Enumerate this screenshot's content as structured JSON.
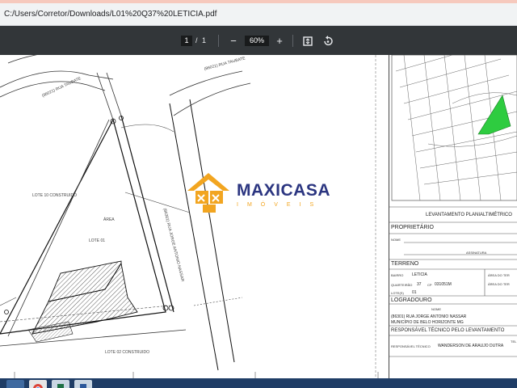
{
  "address_bar": {
    "path": "C:/Users/Corretor/Downloads/L01%20Q37%20LETICIA.pdf"
  },
  "toolbar": {
    "page_current": "1",
    "page_separator": "/",
    "page_total": "1",
    "zoom": "60%",
    "zoom_out": "−",
    "zoom_in": "+"
  },
  "logo": {
    "name": "MAXICASA",
    "tagline": "IMÓVEIS"
  },
  "plan": {
    "street_top": "(86021) RUA TAUBATE",
    "street_right": "(86021) RUA TAUBATE",
    "lote_10": "LOTE 10 CONSTRUIDO",
    "lote_01": "LOTE 01",
    "lote_02": "LOTE 02 CONSTRUIDO",
    "area_label": "ÁREA",
    "street_diag": "(86301) RUA JORGE ANTONIO NASSAR"
  },
  "title_block": {
    "title": "LEVANTAMENTO PLANIALTIMÉTRICO",
    "proprietario": "PROPRIETÁRIO",
    "nome_label": "NOME",
    "assinatura_label": "ASSINATURA",
    "terreno": "TERRENO",
    "bairro_label": "BAIRRO",
    "bairro_value": "LETICIA",
    "quarteirao_label": "QUARTEIRÃO",
    "quarteirao_value": "37",
    "cp_label": "CP",
    "cp_value": "031051M",
    "lotes_label": "LOTE(S)",
    "lotes_value": "01",
    "area_terreno": "ÁREA DO TER",
    "area_terreno2": "ÁREA DO TER",
    "logradouro": "LOGRADOURO",
    "logradouro_nome_label": "NOME",
    "logradouro_value": "(86301) RUA JORGE ANTONIO NASSAR",
    "municipio": "MUNICÍPIO DE BELO HORIZONTE MG",
    "responsavel": "RESPONSÁVEL TÉCNICO PELO LEVANTAMENTO",
    "resp_label": "RESPONSÁVEL TÉCNICO",
    "resp_value": "WANDERSON DE ARAUJO DUTRA",
    "tel_label": "TEL"
  },
  "colors": {
    "toolbar": "#323639",
    "logo_blue": "#2b3580",
    "logo_orange": "#f2a520",
    "highlight_green": "#2ecc40",
    "taskbar": "#1f3d66"
  },
  "icons": [
    "fit-page-icon",
    "rotate-icon",
    "chrome-icon",
    "explorer-icon",
    "excel-icon",
    "word-icon"
  ]
}
